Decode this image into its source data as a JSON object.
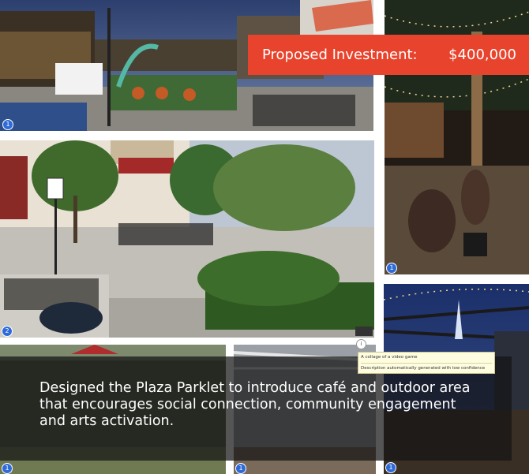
{
  "banner": {
    "label": "Proposed Investment:",
    "amount": "$400,000"
  },
  "caption": {
    "text": "Designed the Plaza Parklet to introduce café and outdoor area that encourages social connection, community engagement and arts activation."
  },
  "alt_text_tooltip": {
    "line1": "A collage of a video game",
    "line2": "Description automatically generated with low confidence"
  },
  "photo_badges": {
    "top_left": "1",
    "top_right": "1",
    "middle": "2",
    "bottom_right": "1",
    "bottom_left": "1",
    "bottom_mid": "1"
  },
  "colors": {
    "banner_red": "#e8432c",
    "caption_overlay": "#141414",
    "badge_blue": "#2f6bd8",
    "tooltip_bg": "#fffde0"
  },
  "icons": {
    "expand": "info-circle-icon"
  }
}
